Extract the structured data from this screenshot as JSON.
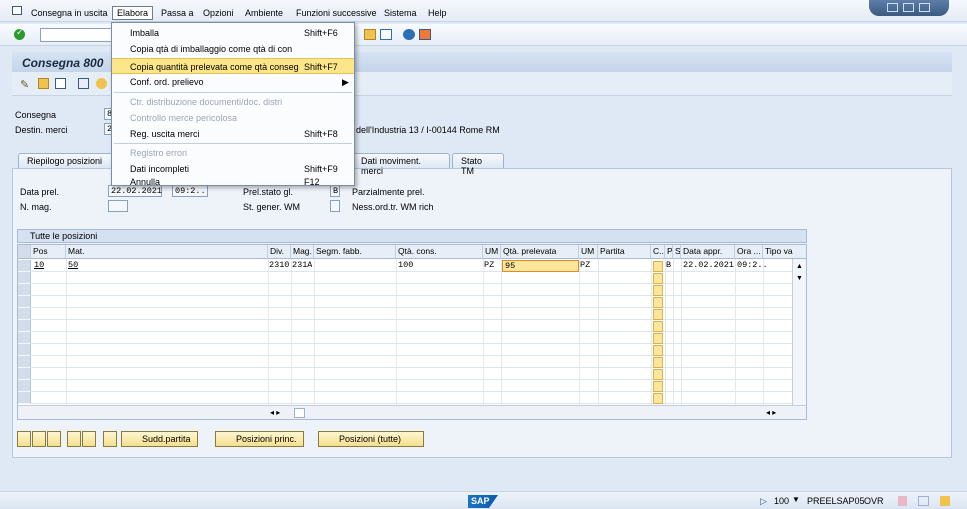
{
  "menubar": {
    "items": [
      "Consegna in uscita",
      "Elabora",
      "Passa a",
      "Opzioni",
      "Ambiente",
      "Funzioni successive",
      "Sistema",
      "Help"
    ]
  },
  "dropdown": {
    "items": [
      {
        "label": "Imballa",
        "shortcut": "Shift+F6",
        "state": "normal"
      },
      {
        "label": "Copia qtà di imballaggio come qtà di con",
        "shortcut": "",
        "state": "normal"
      },
      {
        "label": "Copia quantità prelevata come qtà conseg",
        "shortcut": "Shift+F7",
        "state": "highlight"
      },
      {
        "label": "Conf. ord. prelievo",
        "shortcut": "▶",
        "state": "normal"
      },
      {
        "label": "Ctr. distribuzione documenti/doc. distri",
        "shortcut": "",
        "state": "disabled"
      },
      {
        "label": "Controllo merce pericolosa",
        "shortcut": "",
        "state": "disabled"
      },
      {
        "label": "Reg. uscita merci",
        "shortcut": "Shift+F8",
        "state": "normal"
      },
      {
        "label": "Registro errori",
        "shortcut": "",
        "state": "disabled"
      },
      {
        "label": "Dati incompleti",
        "shortcut": "Shift+F9",
        "state": "normal"
      },
      {
        "label": "Annulla",
        "shortcut": "F12",
        "state": "normal"
      }
    ]
  },
  "title": "Consegna 800",
  "header": {
    "consegna_label": "Consegna",
    "consegna_value": "8",
    "destin_label": "Destin. merci",
    "destin_value": "2",
    "address": "dell'Industria 13 / I-00144 Rome RM"
  },
  "tabs": [
    "Riepilogo posizioni",
    "Dati moviment. merci",
    "Stato TM"
  ],
  "fields": {
    "data_prel_label": "Data prel.",
    "data_prel_value": "22.02.2021",
    "time_value": "09:2..",
    "n_mag_label": "N. mag.",
    "prel_stato_label": "Prel.stato gl.",
    "prel_stato_value": "B",
    "prel_stato_text": "Parzialmente prel.",
    "st_gener_label": "St. gener. WM",
    "st_gener_text": "Ness.ord.tr. WM rich"
  },
  "table": {
    "title": "Tutte le posizioni",
    "columns": [
      "Pos",
      "Mat.",
      "Div.",
      "Mag.",
      "Segm. fabb.",
      "Qtà. cons.",
      "UM",
      "Qtà. prelevata",
      "UM",
      "Partita",
      "C..",
      "P",
      "S",
      "Data appr.",
      "Ora ...",
      "Tipo va"
    ],
    "rows": [
      {
        "pos": "10",
        "mat": "50",
        "div": "2310",
        "mag": "231A",
        "qta_cons": "100",
        "um": "PZ",
        "qta_prel": "95",
        "um2": "PZ",
        "p": "B",
        "data": "22.02.2021",
        "ora": "09:2.."
      }
    ]
  },
  "buttons": {
    "sudd_partita": "Sudd.partita",
    "posizioni_princ": "Posizioni princ.",
    "posizioni_tutte": "Posizioni (tutte)"
  },
  "statusbar": {
    "logo": "SAP",
    "client": "100",
    "system": "PREELSAP05",
    "mode": "OVR"
  }
}
